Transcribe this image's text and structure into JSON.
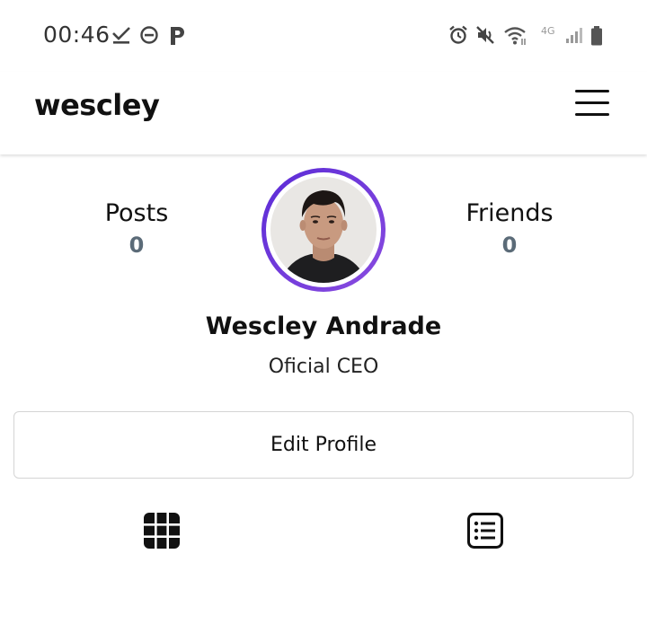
{
  "status_bar": {
    "time": "00:46",
    "left_icons": [
      "download-done-icon",
      "do-not-disturb-icon",
      "p-app-icon"
    ],
    "right_icons": [
      "alarm-icon",
      "mute-icon",
      "wifi-icon",
      "signal-icon",
      "battery-icon"
    ],
    "network": "4G"
  },
  "app_bar": {
    "title": "wescley",
    "menu_icon": "hamburger-menu-icon"
  },
  "profile": {
    "posts_label": "Posts",
    "posts_count": "0",
    "friends_label": "Friends",
    "friends_count": "0",
    "name": "Wescley Andrade",
    "role": "Oficial CEO",
    "edit_label": "Edit Profile",
    "accent_color": "#6a35da"
  },
  "tabs": [
    {
      "icon": "grid-view-icon"
    },
    {
      "icon": "list-view-icon"
    }
  ]
}
